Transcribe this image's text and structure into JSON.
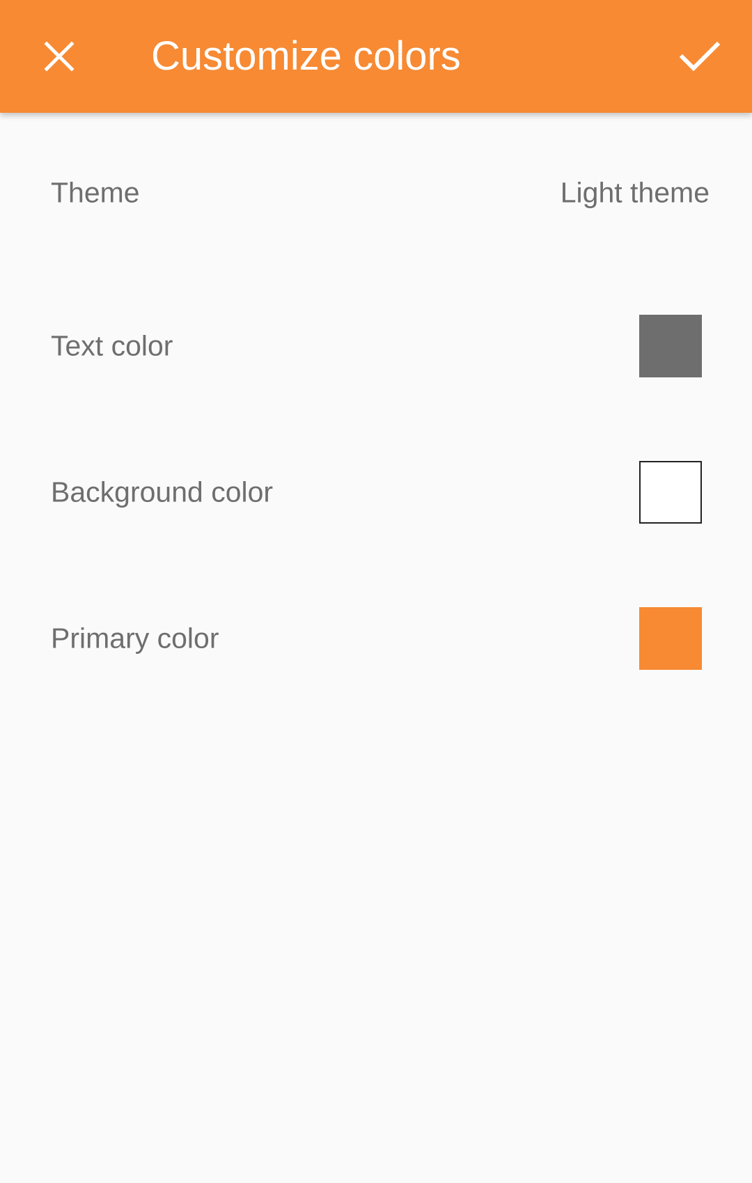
{
  "toolbar": {
    "title": "Customize colors",
    "close_icon": "close-icon",
    "confirm_icon": "check-icon",
    "background_color": "#f78a33"
  },
  "settings": {
    "theme": {
      "label": "Theme",
      "value": "Light theme"
    },
    "text_color": {
      "label": "Text color",
      "color": "#6e6e6e"
    },
    "background_color": {
      "label": "Background color",
      "color": "#ffffff"
    },
    "primary_color": {
      "label": "Primary color",
      "color": "#f78a33"
    }
  }
}
